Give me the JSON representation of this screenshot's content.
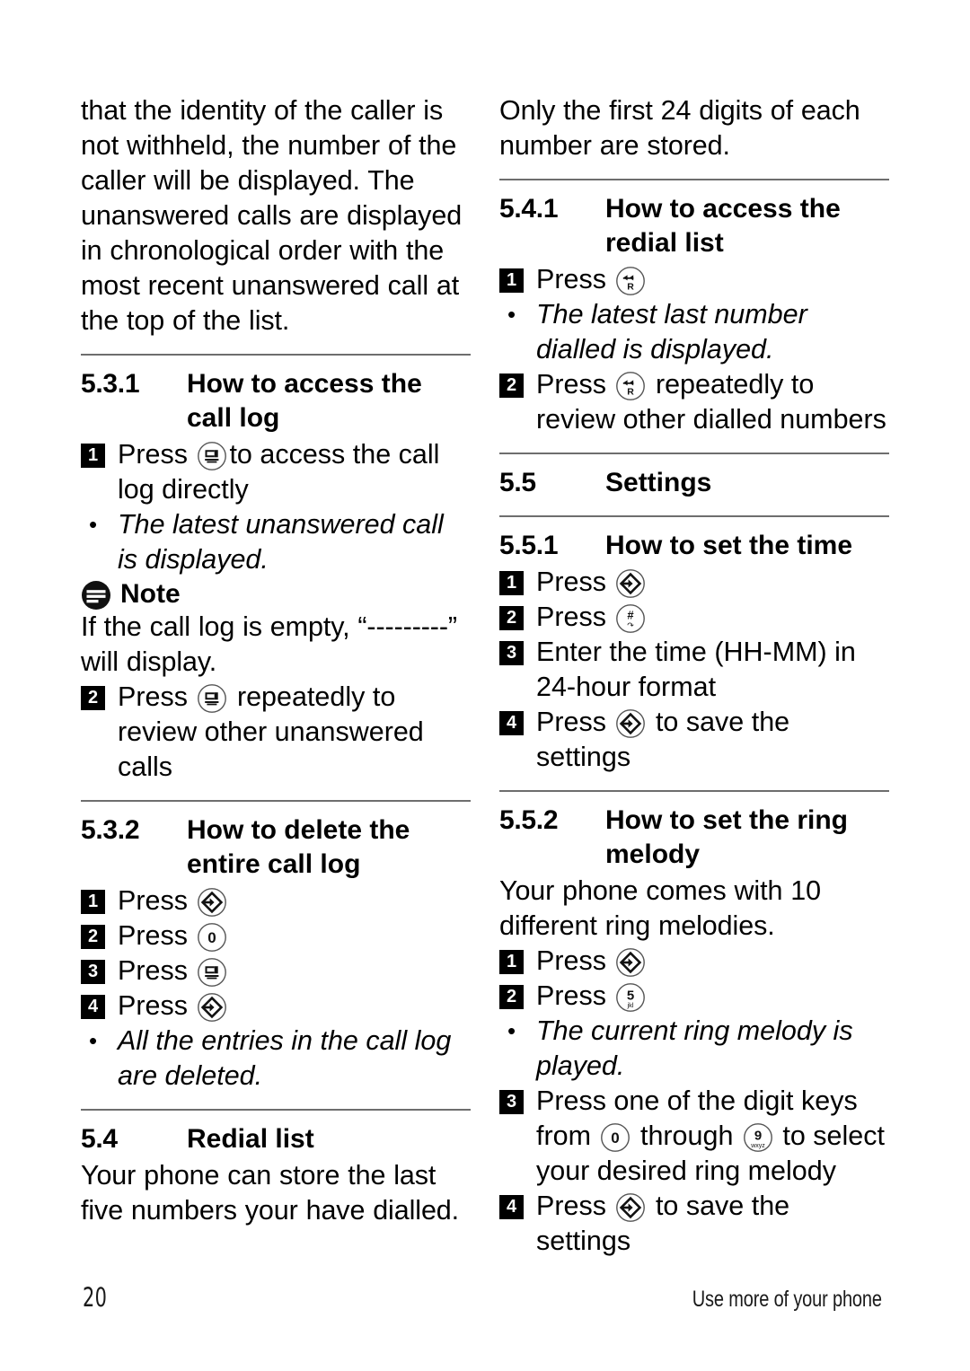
{
  "document": {
    "page_number": "20",
    "footer_text": "Use more of your phone"
  },
  "left_column": {
    "intro_paragraph": "that the identity of the caller is not withheld, the number of the caller will be displayed. The unanswered calls are displayed in chronological order with the most recent unanswered call at the top of the list.",
    "section_531": {
      "number": "5.3.1",
      "title": "How to access the call log",
      "step1_pre": "Press",
      "step1_post": "to access the call log directly",
      "bullet1": "The latest unanswered call is displayed.",
      "note_label": "Note",
      "note_text": "If the call log is empty, “---------” will display.",
      "step2_pre": "Press",
      "step2_post": "repeatedly to review other unanswered calls"
    },
    "section_532": {
      "number": "5.3.2",
      "title": "How to delete the entire call log",
      "step1": "Press",
      "step2": "Press",
      "step3": "Press",
      "step4": "Press",
      "bullet1": "All the entries in the call log are deleted."
    },
    "section_54": {
      "number": "5.4",
      "title": "Redial list",
      "body": "Your phone can store the last five numbers your have dialled."
    }
  },
  "right_column": {
    "intro_paragraph": "Only the first 24 digits of each number are stored.",
    "section_541": {
      "number": "5.4.1",
      "title": "How to access the redial list",
      "step1_pre": "Press",
      "bullet1": "The latest last number dialled is displayed.",
      "step2_pre": "Press",
      "step2_post": "repeatedly to review other dialled numbers"
    },
    "section_55": {
      "number": "5.5",
      "title": "Settings"
    },
    "section_551": {
      "number": "5.5.1",
      "title": "How to set the time",
      "step1": "Press",
      "step2": "Press",
      "step3": "Enter the time (HH-MM) in 24-hour format",
      "step4_pre": "Press",
      "step4_post": "to save the settings"
    },
    "section_552": {
      "number": "5.5.2",
      "title": "How to set the ring melody",
      "body": "Your phone comes with 10 different ring melodies.",
      "step1": "Press",
      "step2": "Press",
      "bullet1": "The current ring melody is played.",
      "step3_a": "Press one of the digit keys from",
      "step3_b": "through",
      "step3_c": "to select your desired ring melody",
      "step4_pre": "Press",
      "step4_post": "to save the settings"
    }
  },
  "keys": {
    "call_log": "call-log-key",
    "menu_ok": "menu-ok-key",
    "redial": "redial-key",
    "hash": "hash-key",
    "digit_0": "0",
    "digit_5": "5",
    "digit_5_letters": "jkl",
    "digit_9": "9",
    "digit_9_letters": "wxyz"
  },
  "colors": {
    "text": "#000000",
    "rule": "#6e6e6e",
    "badge_bg": "#000000",
    "badge_fg": "#ffffff"
  }
}
